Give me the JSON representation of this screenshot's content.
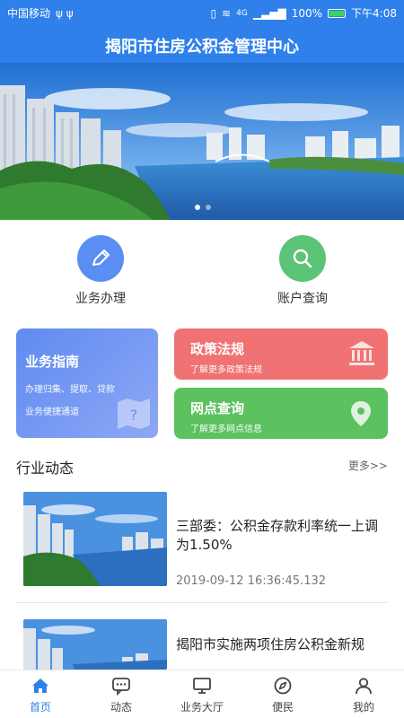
{
  "status": {
    "carrier": "中国移动",
    "signal": "4G",
    "battery": "100%",
    "time": "下午4:08"
  },
  "header": {
    "title": "揭阳市住房公积金管理中心"
  },
  "banner": {
    "indicator_active": 1,
    "indicator_total": 2
  },
  "quick_actions": [
    {
      "label": "业务办理",
      "icon": "pencil-icon",
      "color": "#5a8ef2"
    },
    {
      "label": "账户查询",
      "icon": "search-icon",
      "color": "#5bc476"
    }
  ],
  "cards": {
    "guide": {
      "title": "业务指南",
      "lines": [
        "办理归集、提取、贷款",
        "业务便捷通道"
      ],
      "color_from": "#5f8bf0",
      "color_to": "#8ea7f5"
    },
    "policy": {
      "title": "政策法规",
      "subtitle": "了解更多政策法规",
      "color": "#f07272"
    },
    "outlets": {
      "title": "网点查询",
      "subtitle": "了解更多网点信息",
      "color": "#5cc15f"
    }
  },
  "section": {
    "title": "行业动态",
    "more": "更多>>"
  },
  "news": [
    {
      "title": "三部委：公积金存款利率统一上调为1.50%",
      "date": "2019-09-12 16:36:45.132"
    },
    {
      "title": "揭阳市实施两项住房公积金新规",
      "date": ""
    }
  ],
  "tabs": [
    {
      "label": "首页",
      "icon": "home-icon",
      "active": true
    },
    {
      "label": "动态",
      "icon": "message-icon",
      "active": false
    },
    {
      "label": "业务大厅",
      "icon": "monitor-icon",
      "active": false
    },
    {
      "label": "便民",
      "icon": "compass-icon",
      "active": false
    },
    {
      "label": "我的",
      "icon": "user-icon",
      "active": false
    }
  ]
}
